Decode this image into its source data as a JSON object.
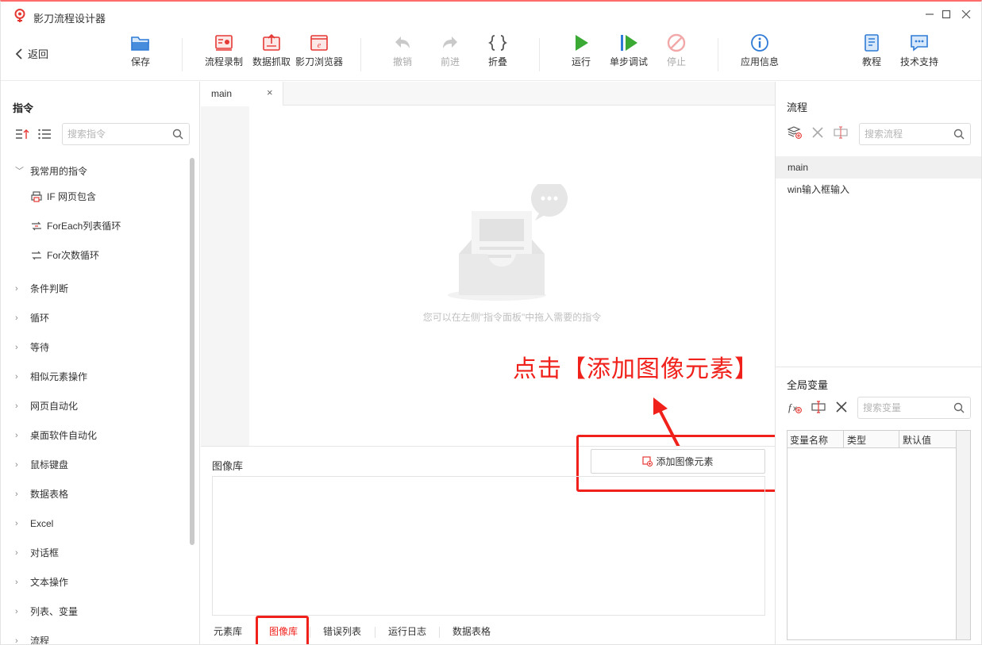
{
  "window": {
    "title": "影刀流程设计器"
  },
  "toolbar": {
    "back": "返回",
    "save": "保存",
    "record": "流程录制",
    "capture": "数据抓取",
    "browser": "影刀浏览器",
    "undo": "撤销",
    "redo": "前进",
    "fold": "折叠",
    "run": "运行",
    "step_debug": "单步调试",
    "stop": "停止",
    "app_info": "应用信息",
    "tutorial": "教程",
    "support": "技术支持"
  },
  "instructions_panel": {
    "title": "指令",
    "search_placeholder": "搜索指令",
    "favorites_group": "我常用的指令",
    "favorites": [
      "IF 网页包含",
      "ForEach列表循环",
      "For次数循环"
    ],
    "categories": [
      "条件判断",
      "循环",
      "等待",
      "相似元素操作",
      "网页自动化",
      "桌面软件自动化",
      "鼠标键盘",
      "数据表格",
      "Excel",
      "对话框",
      "文本操作",
      "列表、变量",
      "流程"
    ]
  },
  "editor": {
    "tab": "main",
    "empty_hint": "您可以在左侧\"指令面板\"中拖入需要的指令"
  },
  "annotation": {
    "text": "点击【添加图像元素】",
    "color": "#f0211b"
  },
  "image_library": {
    "title": "图像库",
    "add_button": "添加图像元素"
  },
  "bottom_tabs": [
    "元素库",
    "图像库",
    "错误列表",
    "运行日志",
    "数据表格"
  ],
  "bottom_tabs_active": "图像库",
  "flows_panel": {
    "title": "流程",
    "search_placeholder": "搜索流程",
    "items": [
      "main",
      "win输入框输入"
    ],
    "selected": "main"
  },
  "variables_panel": {
    "title": "全局变量",
    "search_placeholder": "搜索变量",
    "columns": [
      "变量名称",
      "类型",
      "默认值"
    ]
  },
  "colors": {
    "accent_red": "#f0211b",
    "run_green": "#3aaa35",
    "info_blue": "#2f7bd6"
  }
}
